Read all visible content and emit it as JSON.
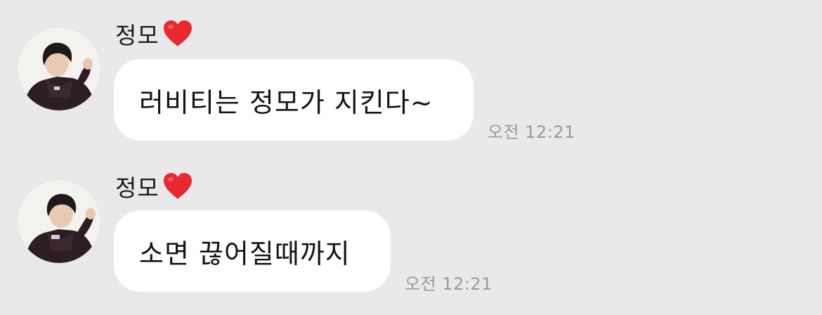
{
  "messages": [
    {
      "sender": "정모",
      "sender_emoji": "heart",
      "text": "러비티는 정모가 지킨다~",
      "time": "오전 12:21"
    },
    {
      "sender": "정모",
      "sender_emoji": "heart",
      "text": "소면 끊어질때까지",
      "time": "오전 12:21"
    }
  ],
  "colors": {
    "background": "#e9e9eb",
    "bubble": "#ffffff",
    "heart": "#e8292f",
    "timestamp": "#9a9a9c"
  }
}
